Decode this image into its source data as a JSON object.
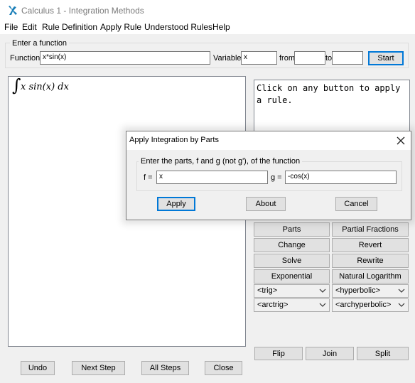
{
  "window": {
    "title": "Calculus 1 - Integration Methods"
  },
  "menu": [
    "File",
    "Edit",
    "Rule Definition",
    "Apply Rule",
    "Understood Rules",
    "Help"
  ],
  "function_group": {
    "title": "Enter a function",
    "function_label": "Function",
    "function_value": "x*sin(x)",
    "variable_label": "Variable",
    "variable_value": "x",
    "from_label": "from",
    "from_value": "",
    "to_label": "to",
    "to_value": "",
    "start_label": "Start"
  },
  "workspace": {
    "integral_sign": "∫",
    "expression": "x sin(x) dx"
  },
  "hint": "Click on any button to apply a rule.",
  "rules": {
    "parts": "Parts",
    "partial_fractions": "Partial Fractions",
    "change": "Change",
    "revert": "Revert",
    "solve": "Solve",
    "rewrite": "Rewrite",
    "exponential": "Exponential",
    "natural_logarithm": "Natural Logarithm",
    "trig": "<trig>",
    "hyperbolic": "<hyperbolic>",
    "arctrig": "<arctrig>",
    "archyperbolic": "<archyperbolic>",
    "flip": "Flip",
    "join": "Join",
    "split": "Split"
  },
  "bottom": {
    "undo": "Undo",
    "next_step": "Next Step",
    "all_steps": "All Steps",
    "close": "Close"
  },
  "dialog": {
    "title": "Apply Integration by Parts",
    "group_title": "Enter the parts, f and g (not g'), of the function",
    "f_label": "f =",
    "f_value": "x",
    "g_label": "g =",
    "g_value": "-cos(x)",
    "apply": "Apply",
    "about": "About",
    "cancel": "Cancel"
  }
}
